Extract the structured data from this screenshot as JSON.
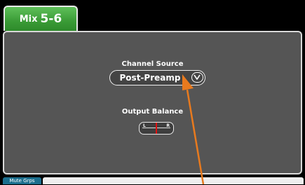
{
  "tab": {
    "label": "Mix",
    "number": "5-6"
  },
  "channel_source": {
    "label": "Channel Source",
    "value": "Post-Preamp"
  },
  "output_balance": {
    "label": "Output Balance",
    "left": "L",
    "right": "R",
    "position": 0.5
  },
  "bottom": {
    "mute_tab": "Mute Grps"
  },
  "colors": {
    "tab_green": "#3a9b36",
    "panel": "#555555",
    "arrow": "#e87a1e",
    "balance_marker": "#e01010",
    "mute_tab": "#1c6f8e"
  }
}
